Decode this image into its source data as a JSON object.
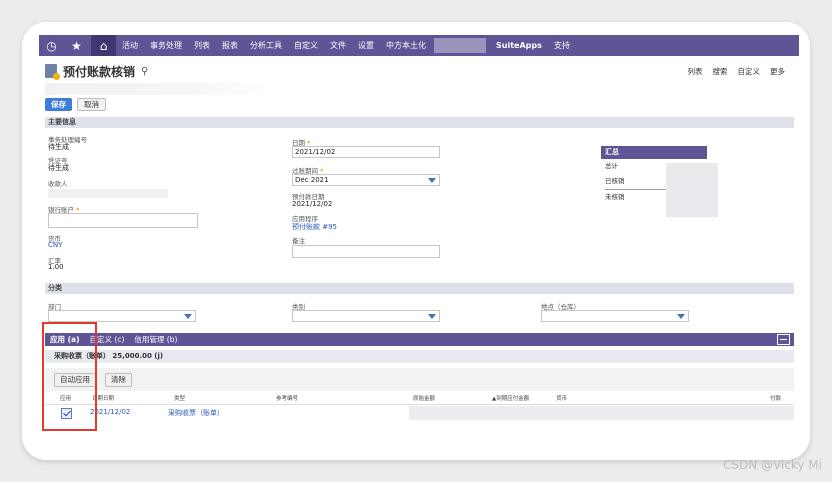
{
  "nav": {
    "items": [
      "活动",
      "事务处理",
      "列表",
      "报表",
      "分析工具",
      "自定义",
      "文件",
      "设置",
      "中方本土化",
      "SuiteApps",
      "支持"
    ]
  },
  "page": {
    "title": "预付账款核销"
  },
  "top_links": [
    "列表",
    "搜索",
    "自定义",
    "更多"
  ],
  "buttons": {
    "save": "保存",
    "cancel": "取消"
  },
  "sections": {
    "main_info": "主要信息",
    "classification": "分类"
  },
  "fields": {
    "txn_no_label": "事务处理编号",
    "txn_no_value": "待生成",
    "voucher_label": "凭证号",
    "voucher_value": "待生成",
    "payee_label": "收款人",
    "bank_label": "银行账户",
    "currency_label": "货币",
    "currency_value": "CNY",
    "rate_label": "汇率",
    "rate_value": "1.00",
    "date_label": "日期",
    "date_value": "2021/12/02",
    "period_label": "过账期间",
    "period_value": "Dec 2021",
    "prepay_date_label": "预付款日期",
    "prepay_date_value": "2021/12/02",
    "applied_to_label": "应用程序",
    "applied_to_value": "预付账款 #95",
    "memo_label": "备注",
    "dept_label": "部门",
    "class_label": "类别",
    "location_label": "地点（仓库）"
  },
  "summary": {
    "title": "汇总",
    "total": "总计",
    "applied": "已核销",
    "unapplied": "未核销"
  },
  "tabs": [
    "应用 (a)",
    "自定义 (c)",
    "信用管理 (b)"
  ],
  "subhead": "采购收票（账单） 25,000.00 (j)",
  "apply_buttons": {
    "auto": "自动应用",
    "clear": "清除"
  },
  "table": {
    "headers": [
      "应用",
      "日期日期",
      "类型",
      "参考编号",
      "原始金额",
      "▲到期应付金额",
      "货币",
      "付款"
    ],
    "row": {
      "date": "2021/12/02",
      "type": "采购收票（账单）"
    }
  },
  "watermark": "CSDN @Vicky Mi",
  "colors": {
    "nav": "#5f5596",
    "primary": "#3f7bd9",
    "annotation": "#e23a2f"
  }
}
